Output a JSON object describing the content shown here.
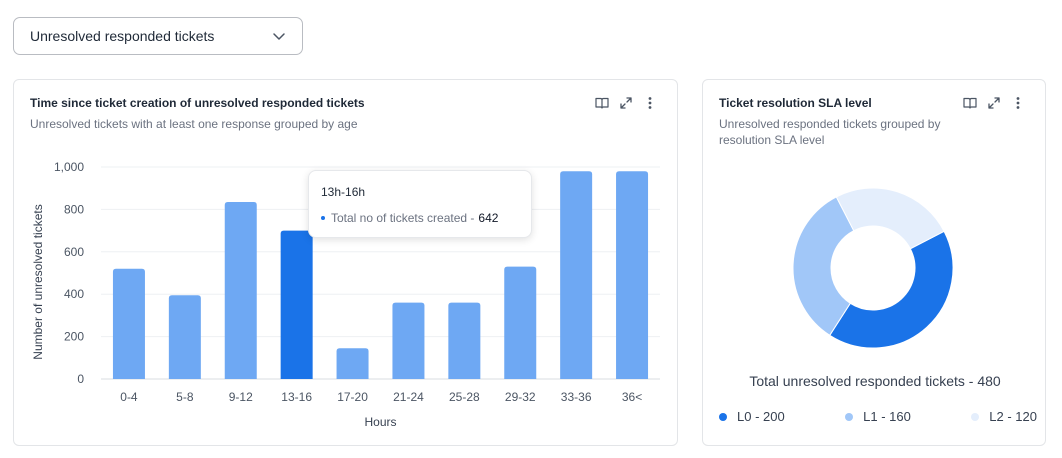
{
  "filter": {
    "selected": "Unresolved responded tickets",
    "icon": "chevron-down-icon"
  },
  "age_card": {
    "title": "Time since ticket creation of unresolved responded tickets",
    "subtitle": "Unresolved tickets with at least one response grouped by age",
    "actions": [
      "book-icon",
      "expand-icon",
      "more-vertical-icon"
    ],
    "tooltip": {
      "title": "13h-16h",
      "label": "Total no of tickets created -",
      "value": "642"
    }
  },
  "sla_card": {
    "title": "Ticket resolution SLA level",
    "subtitle": "Unresolved responded tickets grouped by resolution SLA level",
    "actions": [
      "book-icon",
      "expand-icon",
      "more-vertical-icon"
    ],
    "total_label": "Total unresolved responded  tickets - 480",
    "legend": [
      {
        "label": "L0 - 200",
        "color": "#1a73e8"
      },
      {
        "label": "L1 - 160",
        "color": "#a1c7f8"
      },
      {
        "label": "L2 - 120",
        "color": "#e4eefc"
      }
    ]
  },
  "chart_data": [
    {
      "type": "bar",
      "title": "Time since ticket creation of unresolved responded tickets",
      "xlabel": "Hours",
      "ylabel": "Number of unresolved  tickets",
      "categories": [
        "0-4",
        "5-8",
        "9-12",
        "13-16",
        "17-20",
        "21-24",
        "25-28",
        "29-32",
        "33-36",
        "36<"
      ],
      "values": [
        520,
        395,
        835,
        700,
        145,
        360,
        360,
        530,
        980,
        980
      ],
      "highlighted": "13-16",
      "ylim": [
        0,
        1000
      ],
      "yticks": [
        "0",
        "200",
        "400",
        "600",
        "800",
        "1,000"
      ],
      "ytick_values": [
        0,
        200,
        400,
        600,
        800,
        1000
      ],
      "grid": true,
      "colors": {
        "bar": "#6ea8f3",
        "highlight": "#1a73e8"
      }
    },
    {
      "type": "pie",
      "title": "Ticket resolution SLA level",
      "donut": true,
      "slices": [
        {
          "label": "L0",
          "value": 200,
          "color": "#1a73e8"
        },
        {
          "label": "L1",
          "value": 160,
          "color": "#a1c7f8"
        },
        {
          "label": "L2",
          "value": 120,
          "color": "#e4eefc"
        }
      ]
    }
  ]
}
